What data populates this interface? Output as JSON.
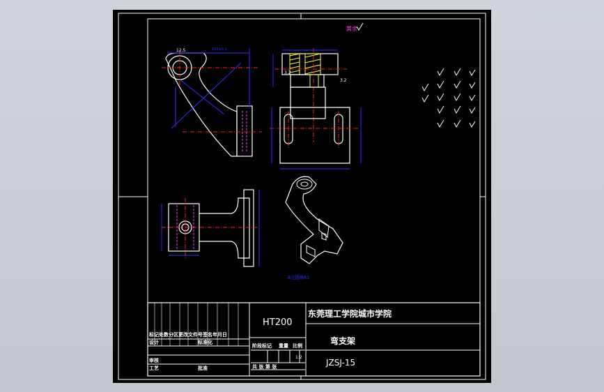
{
  "drawing": {
    "roughness_label": "其余",
    "roughness_values": {
      "hole": "12.5",
      "left_face": "3.2",
      "right_face": "3.2"
    },
    "section_label": "A-A"
  },
  "title_block": {
    "material": "HT200",
    "school": "东莞理工学院城市学院",
    "part_name": "弯支架",
    "drawing_no": "JZSJ-15",
    "scale": "1:2",
    "rev_row": "标记处数分区更改文件号签名年月日",
    "design": "设计",
    "standardize": "标准化",
    "review": "审核",
    "process": "工艺",
    "approve": "批准",
    "stage": "阶段标记",
    "weight": "重量",
    "ratio": "比例",
    "sheets": "共 张 第 张"
  },
  "colors": {
    "line": "#ffffff",
    "center": "#ff2020",
    "hidden": "#ff40ff",
    "dim": "#3030ff",
    "hatch": "#ffff30",
    "text": "#ffff00"
  }
}
